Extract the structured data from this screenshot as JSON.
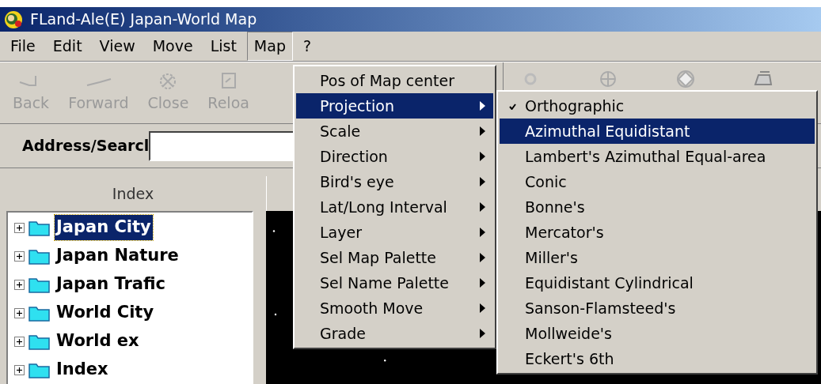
{
  "window": {
    "title": "FLand-Ale(E) Japan-World Map"
  },
  "menu_bar": [
    {
      "label": "File",
      "selected": false
    },
    {
      "label": "Edit",
      "selected": false
    },
    {
      "label": "View",
      "selected": false
    },
    {
      "label": "Move",
      "selected": false
    },
    {
      "label": "List",
      "selected": false
    },
    {
      "label": "Map",
      "selected": true
    },
    {
      "label": "?",
      "selected": false
    }
  ],
  "toolbar": [
    {
      "label": "Back",
      "disabled": true
    },
    {
      "label": "Forward",
      "disabled": true
    },
    {
      "label": "Close",
      "disabled": true
    },
    {
      "label": "Reloa",
      "disabled": true
    }
  ],
  "address": {
    "label": "Address/Searcl"
  },
  "index_panel": {
    "title": "Index",
    "items": [
      {
        "label": "Japan City",
        "selected": true,
        "expanded": false
      },
      {
        "label": "Japan Nature",
        "selected": false,
        "expanded": false
      },
      {
        "label": "Japan Trafic",
        "selected": false,
        "expanded": false
      },
      {
        "label": "World City",
        "selected": false,
        "expanded": false
      },
      {
        "label": "World ex",
        "selected": false,
        "expanded": false
      },
      {
        "label": "Index",
        "selected": false,
        "expanded": false
      }
    ]
  },
  "map_menu": [
    {
      "label": "Pos of Map center",
      "submenu": false,
      "selected": false
    },
    {
      "label": "Projection",
      "submenu": true,
      "selected": true
    },
    {
      "label": "Scale",
      "submenu": true,
      "selected": false
    },
    {
      "label": "Direction",
      "submenu": true,
      "selected": false
    },
    {
      "label": "Bird's eye",
      "submenu": true,
      "selected": false
    },
    {
      "label": "Lat/Long Interval",
      "submenu": true,
      "selected": false
    },
    {
      "label": "Layer",
      "submenu": true,
      "selected": false
    },
    {
      "label": "Sel Map Palette",
      "submenu": true,
      "selected": false
    },
    {
      "label": "Sel Name Palette",
      "submenu": true,
      "selected": false
    },
    {
      "label": "Smooth Move",
      "submenu": true,
      "selected": false
    },
    {
      "label": "Grade",
      "submenu": true,
      "selected": false
    }
  ],
  "projection_menu": [
    {
      "label": "Orthographic",
      "checked": true,
      "selected": false
    },
    {
      "label": "Azimuthal Equidistant",
      "checked": false,
      "selected": true
    },
    {
      "label": "Lambert's Azimuthal Equal-area",
      "checked": false,
      "selected": false
    },
    {
      "label": "Conic",
      "checked": false,
      "selected": false
    },
    {
      "label": "Bonne's",
      "checked": false,
      "selected": false
    },
    {
      "label": "Mercator's",
      "checked": false,
      "selected": false
    },
    {
      "label": "Miller's",
      "checked": false,
      "selected": false
    },
    {
      "label": "Equidistant Cylindrical",
      "checked": false,
      "selected": false
    },
    {
      "label": "Sanson-Flamsteed's",
      "checked": false,
      "selected": false
    },
    {
      "label": "Mollweide's",
      "checked": false,
      "selected": false
    },
    {
      "label": "Eckert's 6th",
      "checked": false,
      "selected": false
    }
  ]
}
